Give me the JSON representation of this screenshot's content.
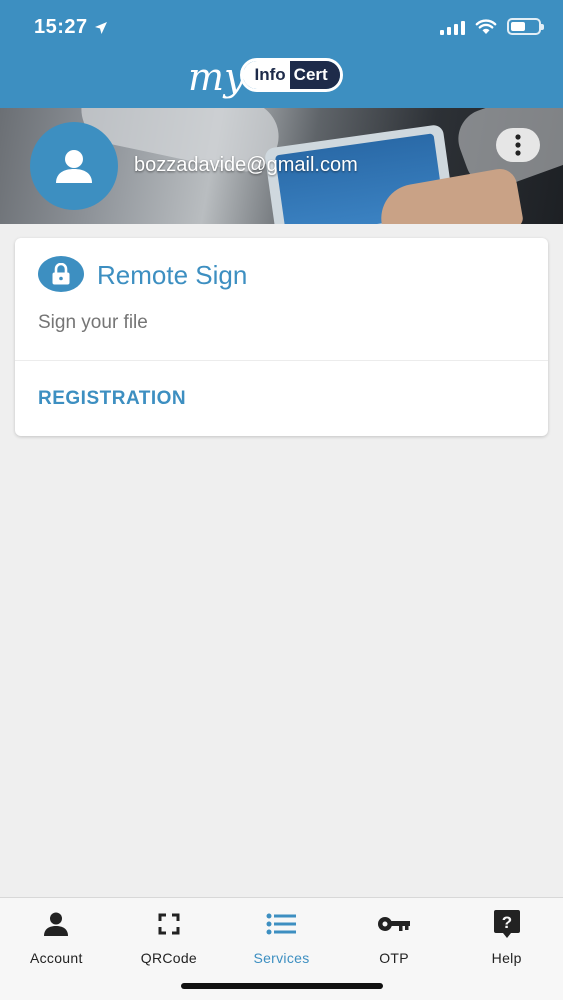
{
  "status_bar": {
    "time": "15:27",
    "location_icon": "location-arrow-icon"
  },
  "header": {
    "logo_my": "my",
    "logo_info": "Info",
    "logo_cert": "Cert"
  },
  "profile": {
    "email": "bozzadavide@gmail.com",
    "avatar_icon": "person-icon",
    "menu_icon": "more-vertical-icon"
  },
  "service_card": {
    "icon": "lock-icon",
    "title": "Remote Sign",
    "subtitle": "Sign your file",
    "action_label": "REGISTRATION"
  },
  "tabs": [
    {
      "label": "Account",
      "icon": "person-icon",
      "active": false
    },
    {
      "label": "QRCode",
      "icon": "qrcode-scan-icon",
      "active": false
    },
    {
      "label": "Services",
      "icon": "list-icon",
      "active": true
    },
    {
      "label": "OTP",
      "icon": "key-icon",
      "active": false
    },
    {
      "label": "Help",
      "icon": "help-icon",
      "active": false
    }
  ],
  "colors": {
    "brand": "#3d8fc1",
    "brand_dark": "#1e2b4a",
    "background": "#efefef"
  }
}
